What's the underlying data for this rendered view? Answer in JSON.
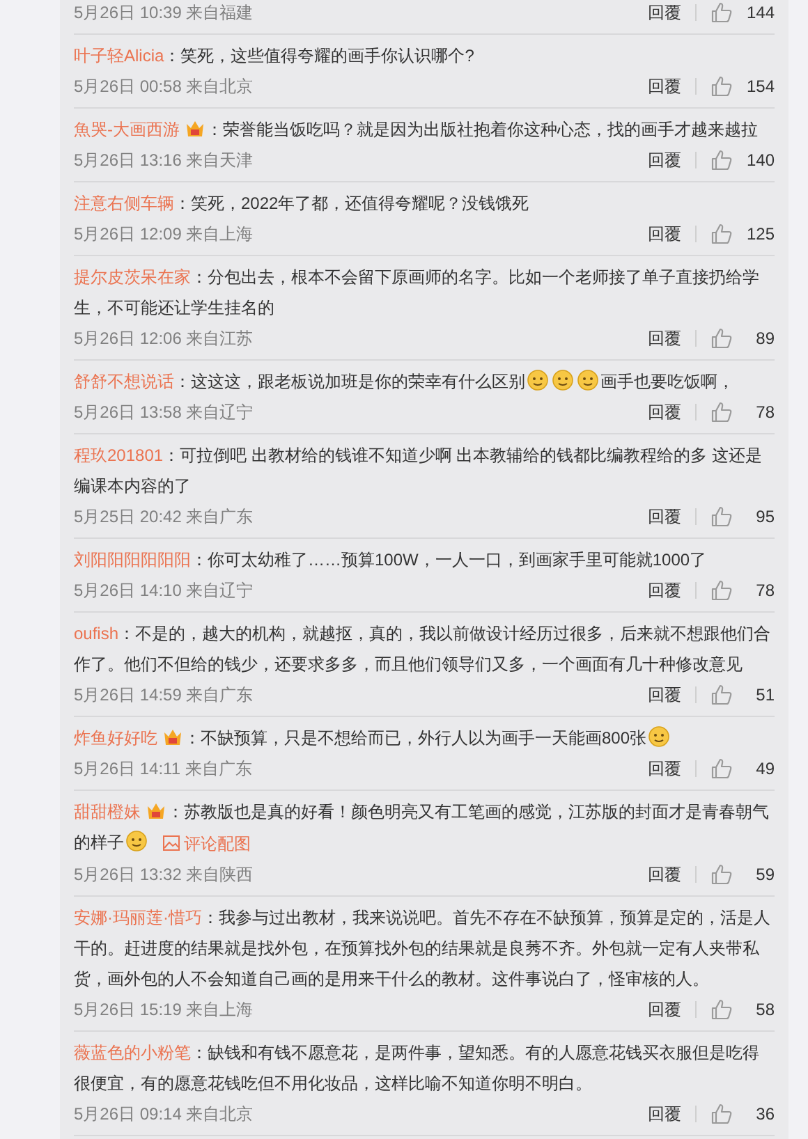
{
  "comments": [
    {
      "time": "5月26日 10:39 来自福建",
      "reply": "回覆",
      "likes": "144"
    },
    {
      "user": "叶子轻Alicia",
      "badge": false,
      "parts": [
        {
          "kind": "text",
          "text": "：笑死，这些值得夸耀的画手你认识哪个?"
        }
      ],
      "time": "5月26日 00:58 来自北京",
      "reply": "回覆",
      "likes": "154"
    },
    {
      "user": "魚哭-大画西游",
      "badge": true,
      "parts": [
        {
          "kind": "text",
          "text": "：荣誉能当饭吃吗？就是因为出版社抱着你这种心态，找的画手才越来越拉"
        }
      ],
      "time": "5月26日 13:16 来自天津",
      "reply": "回覆",
      "likes": "140"
    },
    {
      "user": "注意右侧车辆",
      "badge": false,
      "parts": [
        {
          "kind": "text",
          "text": "：笑死，2022年了都，还值得夸耀呢？没钱饿死"
        }
      ],
      "time": "5月26日 12:09 来自上海",
      "reply": "回覆",
      "likes": "125"
    },
    {
      "user": "提尔皮茨呆在家",
      "badge": false,
      "parts": [
        {
          "kind": "text",
          "text": "：分包出去，根本不会留下原画师的名字。比如一个老师接了单子直接扔给学生，不可能还让学生挂名的"
        }
      ],
      "time": "5月26日 12:06 来自江苏",
      "reply": "回覆",
      "likes": "89"
    },
    {
      "user": "舒舒不想说话",
      "badge": false,
      "parts": [
        {
          "kind": "text",
          "text": "：这这这，跟老板说加班是你的荣幸有什么区别"
        },
        {
          "kind": "emoji"
        },
        {
          "kind": "emoji"
        },
        {
          "kind": "emoji"
        },
        {
          "kind": "text",
          "text": "画手也要吃饭啊，"
        }
      ],
      "time": "5月26日 13:58 来自辽宁",
      "reply": "回覆",
      "likes": "78"
    },
    {
      "user": "程玖201801",
      "badge": false,
      "parts": [
        {
          "kind": "text",
          "text": "：可拉倒吧 出教材给的钱谁不知道少啊 出本教辅给的钱都比编教程给的多 这还是编课本内容的了"
        }
      ],
      "time": "5月25日 20:42 来自广东",
      "reply": "回覆",
      "likes": "95"
    },
    {
      "user": "刘阳阳阳阳阳阳",
      "badge": false,
      "parts": [
        {
          "kind": "text",
          "text": "：你可太幼稚了……预算100W，一人一口，到画家手里可能就1000了"
        }
      ],
      "time": "5月26日 14:10 来自辽宁",
      "reply": "回覆",
      "likes": "78"
    },
    {
      "user": "oufish",
      "badge": false,
      "parts": [
        {
          "kind": "text",
          "text": "：不是的，越大的机构，就越抠，真的，我以前做设计经历过很多，后来就不想跟他们合作了。他们不但给的钱少，还要求多多，而且他们领导们又多，一个画面有几十种修改意见"
        }
      ],
      "time": "5月26日 14:59 来自广东",
      "reply": "回覆",
      "likes": "51"
    },
    {
      "user": "炸鱼好好吃",
      "badge": true,
      "parts": [
        {
          "kind": "text",
          "text": "：不缺预算，只是不想给而已，外行人以为画手一天能画800张"
        },
        {
          "kind": "emoji"
        }
      ],
      "time": "5月26日 14:11 来自广东",
      "reply": "回覆",
      "likes": "49"
    },
    {
      "user": "甜甜橙妹",
      "badge": true,
      "parts": [
        {
          "kind": "text",
          "text": "：苏教版也是真的好看！颜色明亮又有工笔画的感觉，江苏版的封面才是青春朝气的样子"
        },
        {
          "kind": "emoji"
        },
        {
          "kind": "link",
          "text": "评论配图"
        }
      ],
      "time": "5月26日 13:32 来自陕西",
      "reply": "回覆",
      "likes": "59"
    },
    {
      "user": "安娜·玛丽莲·惜巧",
      "badge": false,
      "parts": [
        {
          "kind": "text",
          "text": "：我参与过出教材，我来说说吧。首先不存在不缺预算，预算是定的，活是人干的。赶进度的结果就是找外包，在预算找外包的结果就是良莠不齐。外包就一定有人夹带私货，画外包的人不会知道自己画的是用来干什么的教材。这件事说白了，怪审核的人。"
        }
      ],
      "time": "5月26日 15:19 来自上海",
      "reply": "回覆",
      "likes": "58"
    },
    {
      "user": "薇蓝色的小粉笔",
      "badge": false,
      "parts": [
        {
          "kind": "text",
          "text": "：缺钱和有钱不愿意花，是两件事，望知悉。有的人愿意花钱买衣服但是吃得很便宜，有的愿意花钱吃但不用化妆品，这样比喻不知道你明不明白。"
        }
      ],
      "time": "5月26日 09:14 来自北京",
      "reply": "回覆",
      "likes": "36"
    }
  ]
}
